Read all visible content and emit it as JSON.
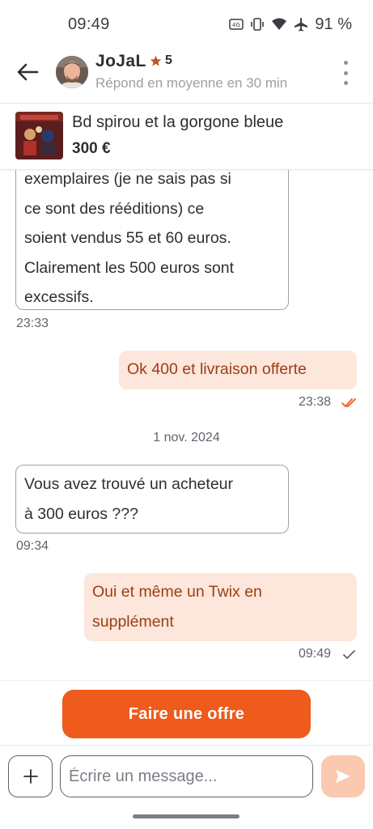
{
  "status_bar": {
    "time": "09:49",
    "battery": "91 %",
    "icons": [
      "hd-voice-icon",
      "vibrate-icon",
      "wifi-icon",
      "airplane-icon"
    ]
  },
  "header": {
    "back_icon": "back-arrow-icon",
    "name": "JoJaL",
    "rating": "5",
    "rating_icon": "star-icon",
    "subtitle": "Répond en moyenne en 30 min",
    "menu_icon": "kebab-menu-icon"
  },
  "product": {
    "title": "Bd spirou et la gorgone bleue",
    "price": "300 €"
  },
  "messages": [
    {
      "direction": "in",
      "lines": [
        "exemplaires (je ne sais pas si",
        "ce sont des rééditions) ce",
        "soient vendus 55 et 60 euros.",
        "Clairement les 500 euros sont",
        "excessifs."
      ],
      "time": "23:33"
    },
    {
      "direction": "out",
      "lines": [
        "Ok 400 et livraison offerte"
      ],
      "time": "23:38",
      "status": "read"
    },
    {
      "date_separator": "1 nov. 2024"
    },
    {
      "direction": "in",
      "lines": [
        "Vous avez trouvé un acheteur",
        "à 300 euros ???"
      ],
      "time": "09:34"
    },
    {
      "direction": "out",
      "lines": [
        "Oui et même un Twix en",
        "supplément"
      ],
      "time": "09:49",
      "status": "sent"
    }
  ],
  "offer_button": {
    "label": "Faire une offre"
  },
  "composer": {
    "placeholder": "Écrire un message...",
    "add_icon": "plus-icon",
    "send_icon": "send-icon"
  },
  "colors": {
    "accent": "#ee5b1d",
    "outgoing_bubble": "#fde6dc",
    "outgoing_text": "#9a3f14",
    "send_button_disabled": "#fbc8b0",
    "read_ticks": "#ee5b1d"
  }
}
